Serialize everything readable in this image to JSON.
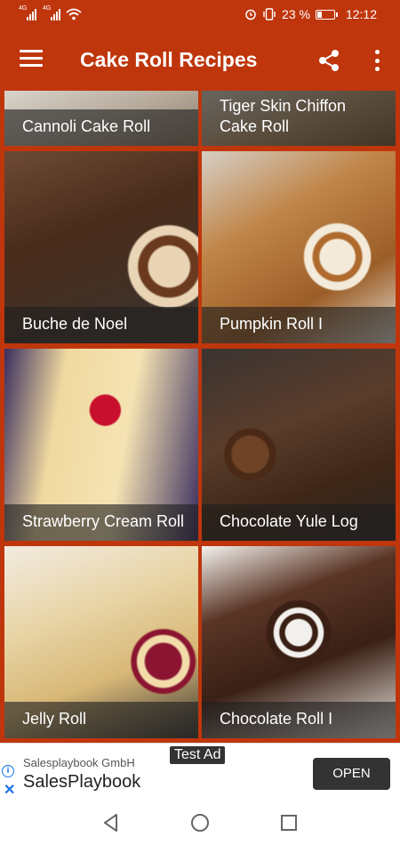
{
  "status_bar": {
    "network_1": "4G",
    "network_2": "4G",
    "battery_percent": "23 %",
    "battery_level": 0.23,
    "time": "12:12",
    "icons": [
      "signal-icon",
      "wifi-icon",
      "alarm-icon",
      "vibrate-icon",
      "battery-icon"
    ]
  },
  "app_bar": {
    "title": "Cake Roll Recipes",
    "color": "#bf360c",
    "icons": [
      "menu-icon",
      "share-icon",
      "more-vert-icon"
    ]
  },
  "recipes": [
    {
      "title": "Cannoli Cake Roll"
    },
    {
      "title": "Tiger Skin Chiffon Cake Roll"
    },
    {
      "title": "Buche de Noel"
    },
    {
      "title": "Pumpkin Roll I"
    },
    {
      "title": "Strawberry Cream Roll"
    },
    {
      "title": "Chocolate Yule Log"
    },
    {
      "title": "Jelly Roll"
    },
    {
      "title": "Chocolate Roll I"
    }
  ],
  "ad": {
    "badge": "Test Ad",
    "advertiser": "Salesplaybook GmbH",
    "name": "SalesPlaybook",
    "cta": "OPEN",
    "icons": [
      "info-icon",
      "close-icon"
    ]
  },
  "nav_bar": {
    "icons": [
      "back-icon",
      "home-icon",
      "recents-icon"
    ]
  }
}
